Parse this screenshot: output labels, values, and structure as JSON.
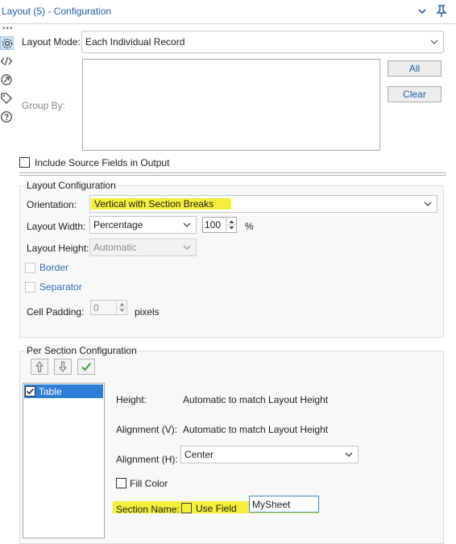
{
  "window": {
    "title": "Layout (5) - Configuration"
  },
  "layout_mode": {
    "label": "Layout Mode:",
    "value": "Each Individual Record"
  },
  "group_by": {
    "label": "Group By:",
    "all_button": "All",
    "clear_button": "Clear"
  },
  "include_source": {
    "label": "Include Source Fields in Output"
  },
  "layout_config": {
    "title": "Layout Configuration",
    "orientation": {
      "label": "Orientation:",
      "value": "Vertical with Section Breaks"
    },
    "layout_width": {
      "label": "Layout Width:",
      "value": "Percentage",
      "number": "100",
      "unit": "%"
    },
    "layout_height": {
      "label": "Layout Height:",
      "value": "Automatic"
    },
    "border": {
      "label": "Border"
    },
    "separator": {
      "label": "Separator"
    },
    "cell_padding": {
      "label": "Cell Padding:",
      "value": "0",
      "unit": "pixels"
    }
  },
  "per_section": {
    "title": "Per Section Configuration",
    "list_items": [
      "Table"
    ],
    "height": {
      "label": "Height:",
      "value": "Automatic to match Layout Height"
    },
    "alignment_v": {
      "label": "Alignment (V):",
      "value": "Automatic to match Layout Height"
    },
    "alignment_h": {
      "label": "Alignment (H):",
      "value": "Center"
    },
    "fill_color": {
      "label": "Fill Color"
    },
    "section_name": {
      "label": "Section Name:",
      "use_field_label": "Use Field",
      "value": "MySheet"
    }
  },
  "colors": {
    "accent": "#1f5fa8",
    "highlight": "#f4ef3b"
  }
}
